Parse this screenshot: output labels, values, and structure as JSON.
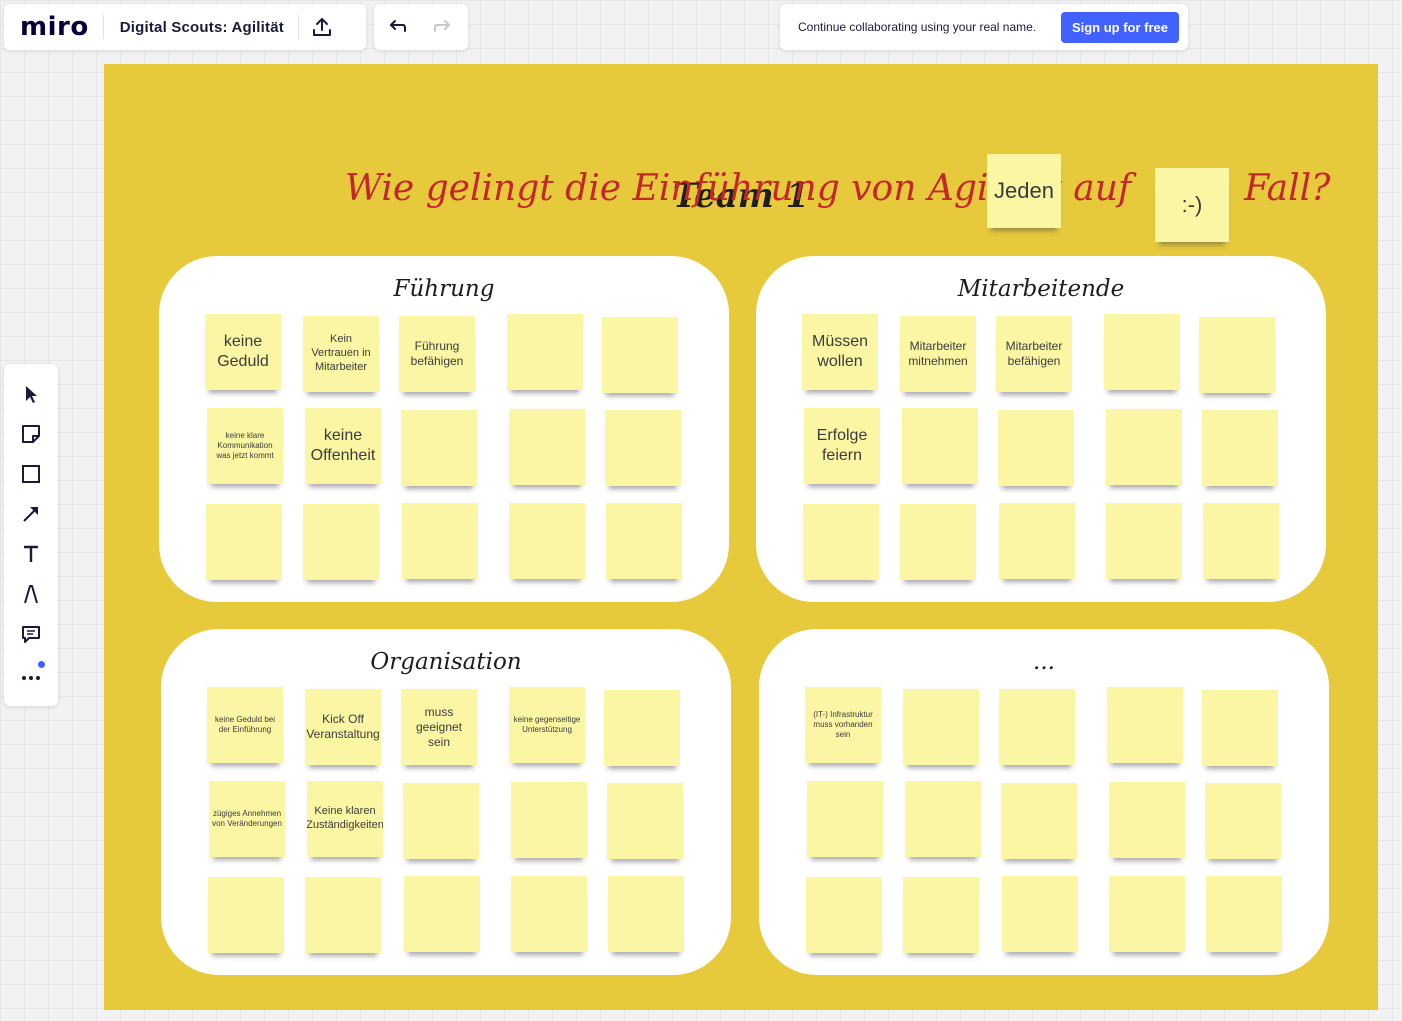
{
  "app": {
    "logo": "miro",
    "board_title": "Digital Scouts: Agilität",
    "collab_message": "Continue collaborating using your real name.",
    "signup_label": "Sign up for free"
  },
  "toolbar": {
    "tools": [
      "select-icon",
      "sticky-note-icon",
      "shape-icon",
      "connector-icon",
      "text-icon",
      "pen-icon",
      "comment-icon",
      "more-icon"
    ]
  },
  "board": {
    "heading": "Team 1",
    "question_part1": "Wie gelingt die Einführung von Agilität auf",
    "question_part2": "Fall?",
    "sticky_jeden": "Jeden",
    "sticky_smiley": ":-)",
    "colors": {
      "board": "#e7c93c",
      "question": "#c3262b",
      "sticky": "#fbf6a4",
      "accent": "#4262ff"
    },
    "quadrants": [
      {
        "title": "Führung",
        "notes": [
          "keine Geduld",
          "Kein Vertrauen in Mitarbeiter",
          "Führung befähigen",
          "",
          "",
          "keine klare Kommunikation was jetzt kommt",
          "keine Offenheit",
          "",
          "",
          "",
          "",
          "",
          "",
          "",
          ""
        ]
      },
      {
        "title": "Mitarbeitende",
        "notes": [
          "Müssen wollen",
          "Mitarbeiter mitnehmen",
          "Mitarbeiter befähigen",
          "",
          "",
          "Erfolge feiern",
          "",
          "",
          "",
          "",
          "",
          "",
          "",
          "",
          ""
        ]
      },
      {
        "title": "Organisation",
        "notes": [
          "keine Geduld bei der Einführung",
          "Kick Off Veranstaltung",
          "muss geeignet sein",
          "keine gegenseitige Unterstützung",
          "",
          "zügiges Annehmen von Veränderungen",
          "Keine klaren Zuständigkeiten",
          "",
          "",
          "",
          "",
          "",
          "",
          "",
          ""
        ]
      },
      {
        "title": "...",
        "notes": [
          "(IT-) Infrastruktur muss vorhanden sein",
          "",
          "",
          "",
          "",
          "",
          "",
          "",
          "",
          "",
          "",
          "",
          "",
          "",
          ""
        ]
      }
    ]
  }
}
